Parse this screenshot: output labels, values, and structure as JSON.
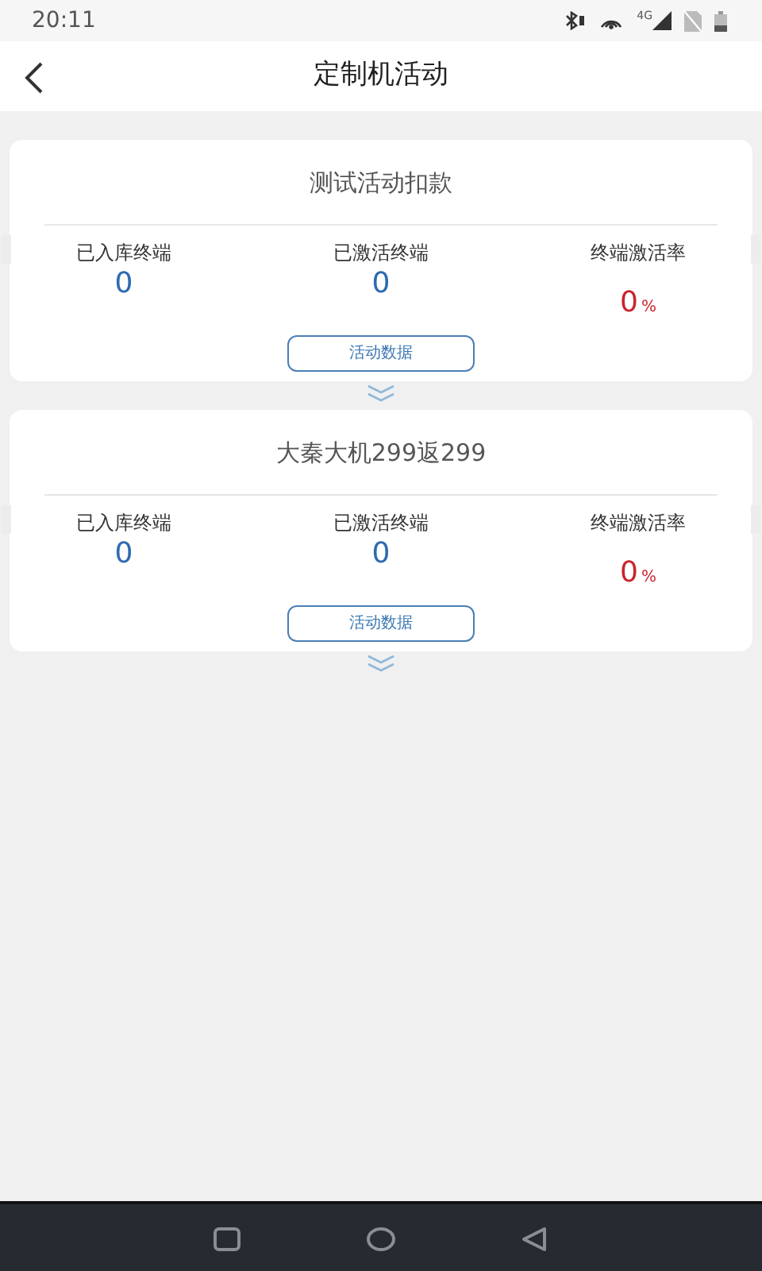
{
  "status_bar": {
    "time": "20:11",
    "network": "4G"
  },
  "header": {
    "title": "定制机活动"
  },
  "activities": [
    {
      "title": "测试活动扣款",
      "stats": [
        {
          "label": "已入库终端",
          "value": "0",
          "kind": "count"
        },
        {
          "label": "已激活终端",
          "value": "0",
          "kind": "count"
        },
        {
          "label": "终端激活率",
          "value": "0",
          "unit": "%",
          "kind": "rate"
        }
      ],
      "button": "活动数据"
    },
    {
      "title": "大秦大机299返299",
      "stats": [
        {
          "label": "已入库终端",
          "value": "0",
          "kind": "count"
        },
        {
          "label": "已激活终端",
          "value": "0",
          "kind": "count"
        },
        {
          "label": "终端激活率",
          "value": "0",
          "unit": "%",
          "kind": "rate"
        }
      ],
      "button": "活动数据"
    }
  ]
}
